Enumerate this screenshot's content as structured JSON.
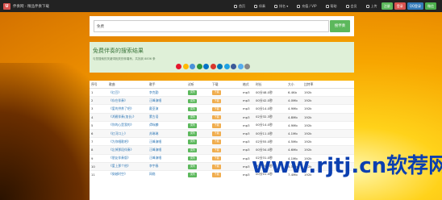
{
  "topbar": {
    "logo_badge": "U",
    "site_title": "伴奏网 - 精品伴奏下载",
    "nav": [
      {
        "label": "首页",
        "icon": "home-icon"
      },
      {
        "label": "伴奏",
        "icon": "music-icon"
      },
      {
        "label": "排名 ▾",
        "icon": "list-icon"
      },
      {
        "label": "充值 / VIP",
        "icon": "vip-icon"
      },
      {
        "label": "帮助",
        "icon": "help-icon"
      },
      {
        "label": "会员",
        "icon": "user-icon"
      },
      {
        "label": "上传",
        "icon": "upload-icon"
      }
    ],
    "buttons": [
      "注册",
      "登录",
      "QQ登录",
      "微信"
    ]
  },
  "search": {
    "value": "免费",
    "button": "搜伴奏"
  },
  "results": {
    "title": "免费伴奏的搜索结果",
    "subtitle": "与您搜索的关键词相关的伴奏有，共找到 8836 条",
    "share_icons": [
      "weibo",
      "qzone",
      "tieba",
      "douban",
      "renren",
      "kaixin",
      "linkedin",
      "qq",
      "facebook",
      "twitter",
      "more"
    ]
  },
  "table": {
    "headers": [
      "序号",
      "歌曲",
      "歌手",
      "试听",
      "下载",
      "格式",
      "时长",
      "大小",
      "比特率"
    ],
    "listen_label": "试听",
    "download_label": "下载",
    "rows": [
      {
        "no": "1",
        "song": "《红豆》",
        "singer": "李克勤",
        "fmt": "mp3",
        "time": "00分48.0秒",
        "size": "6.4Kb",
        "rate": "192k"
      },
      {
        "no": "2",
        "song": "《存在伴奏》",
        "singer": "汪峰演唱",
        "fmt": "mp3",
        "time": "00分42.0秒",
        "size": "4.0Mb",
        "rate": "192k"
      },
      {
        "no": "3",
        "song": "《爱的供养了吧》",
        "singer": "戴荃演",
        "fmt": "mp3",
        "time": "00分14.0秒",
        "size": "4.9Mb",
        "rate": "192k"
      },
      {
        "no": "4",
        "song": "《鸿雁伴奏(加长)》",
        "singer": "蒙古语",
        "fmt": "mp3",
        "time": "02分32.3秒",
        "size": "4.8Mb",
        "rate": "192k"
      },
      {
        "no": "5",
        "song": "《你的心是我的》",
        "singer": "谭咏麟",
        "fmt": "mp3",
        "time": "00分14.0秒",
        "size": "4.9Mb",
        "rate": "192k"
      },
      {
        "no": "6",
        "song": "《红河口上》",
        "singer": "苏琳琳",
        "fmt": "mp3",
        "time": "00分11.0秒",
        "size": "4.1Mb",
        "rate": "192k"
      },
      {
        "no": "7",
        "song": "《为你唱歌吧》",
        "singer": "汪峰演唱",
        "fmt": "mp3",
        "time": "02分55.0秒",
        "size": "4.5Mb",
        "rate": "192k"
      },
      {
        "no": "8",
        "song": "《忘掉那段伴奏》",
        "singer": "汪峰演唱",
        "fmt": "mp3",
        "time": "00分34.0秒",
        "size": "4.6Mb",
        "rate": "192k"
      },
      {
        "no": "9",
        "song": "《朋友伴奏版》",
        "singer": "汪峰演唱",
        "fmt": "mp3",
        "time": "02分31.0秒",
        "size": "4.1Mb",
        "rate": "192k"
      },
      {
        "no": "10",
        "song": "《爱上那个他》",
        "singer": "李宇春",
        "fmt": "mp3",
        "time": "00分20.0秒",
        "size": "5.3Mb",
        "rate": "192k"
      },
      {
        "no": "11",
        "song": "《穿越时空》",
        "singer": "网络",
        "fmt": "mp3",
        "time": "00分01.0秒",
        "size": "7.4Mb",
        "rate": "192k"
      }
    ]
  },
  "watermark": {
    "text": "www.rjtj.cn软荐网"
  }
}
